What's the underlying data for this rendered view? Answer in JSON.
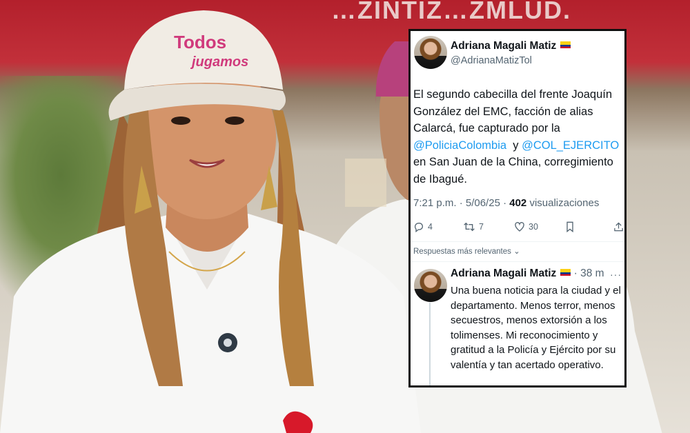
{
  "photo": {
    "awning_text": "…ZINTIZ…ZMLUD.",
    "cap_text_line1": "Todos",
    "cap_text_line2": "jugamos"
  },
  "tweet": {
    "author_name": "Adriana Magali Matiz",
    "author_handle": "@AdrianaMatizTol",
    "text_part1": "El segundo cabecilla del frente Joaquín González del EMC, facción de alias Calarcá, fue capturado por la ",
    "mention1": "@PoliciaColombia",
    "text_part2": "  y ",
    "mention2": "@COL_EJERCITO",
    "text_part3": " en San Juan de la China, corregimiento de Ibagué.",
    "time": "7:21 p.m. · 5/06/25 · ",
    "views_count": "402",
    "views_label": " visualizaciones",
    "replies": "4",
    "retweets": "7",
    "likes": "30",
    "icons": [
      "reply-icon",
      "retweet-icon",
      "like-icon",
      "bookmark-icon",
      "share-icon",
      "flag-colombia-icon"
    ]
  },
  "sort_label": "Respuestas más relevantes",
  "reply": {
    "author_name": "Adriana Magali Matiz",
    "time": "· 38 m",
    "more": "···",
    "text": "Una buena noticia para la ciudad y el departamento. Menos terror, menos secuestros, menos extorsión a los tolimenses. Mi reconocimiento y gratitud a la Policía y Ejército por su valentía y tan acertado operativo."
  },
  "colors": {
    "mention_blue": "#1d9bf0",
    "secondary_text": "#536471",
    "primary_text": "#0f1419",
    "card_border": "#0f0f0f",
    "awning_red": "#b3202c"
  }
}
